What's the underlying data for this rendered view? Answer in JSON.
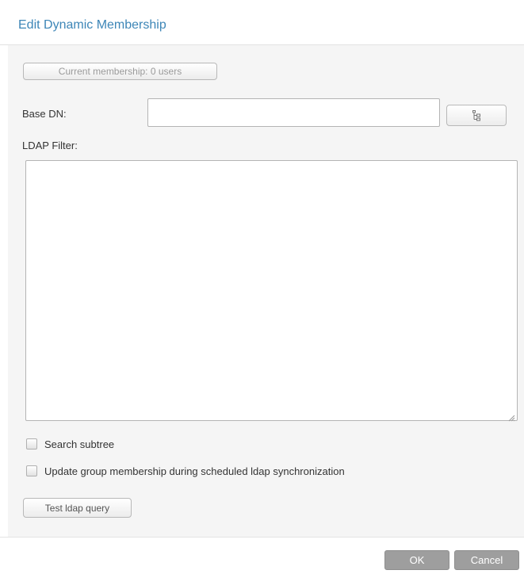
{
  "dialog": {
    "title": "Edit Dynamic Membership"
  },
  "membership": {
    "button_label": "Current membership: 0 users"
  },
  "base_dn": {
    "label": "Base DN:",
    "value": "",
    "browse_icon": "tree-icon"
  },
  "ldap_filter": {
    "label": "LDAP Filter:",
    "value": ""
  },
  "options": {
    "search_subtree": {
      "label": "Search subtree",
      "checked": false
    },
    "update_membership": {
      "label": "Update group membership during scheduled ldap synchronization",
      "checked": false
    }
  },
  "test": {
    "button_label": "Test ldap query"
  },
  "footer": {
    "ok_label": "OK",
    "cancel_label": "Cancel"
  }
}
